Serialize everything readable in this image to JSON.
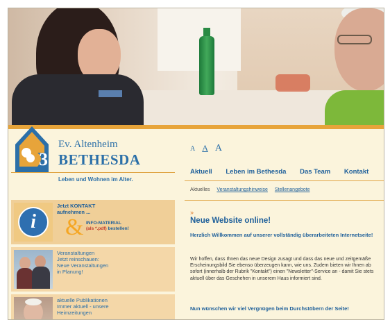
{
  "organization": {
    "name": "Ev. Altenheim",
    "title": "BETHESDA",
    "tagline": "Leben und Wohnen im Alter."
  },
  "font_size_controls": [
    "A",
    "A",
    "A"
  ],
  "nav": {
    "items": [
      "Aktuell",
      "Leben im Bethesda",
      "Das Team",
      "Kontakt"
    ]
  },
  "sub_nav": {
    "current": "Aktuelles",
    "links": [
      "Veranstaltungshinweise",
      "Stellenangebote"
    ]
  },
  "sidebar": {
    "contact": {
      "line1": "Jetzt KONTAKT",
      "line2": "aufnehmen ...",
      "info_line1": "INFO-MATERIAL",
      "info_line2a": "(als *.pdf)",
      "info_line2b": "bestellen!"
    },
    "events": {
      "title": "Veranstaltungen",
      "lines": [
        "Jetzt reinschauen:",
        "Neue Veranstaltungen",
        "in Planung!"
      ]
    },
    "publications": {
      "title": "aktuelle Publikationen",
      "lines": [
        "Immer aktuell - unsere",
        "Heimzeitungen",
        "..."
      ]
    }
  },
  "article": {
    "title": "Neue Website online!",
    "intro": "Herzlich Willkommen auf unserer vollständig überarbeiteten Internetseite!",
    "body": "Wir hoffen, dass Ihnen das neue Design zusagt und dass das neue und zeitgemäße Erscheinungsbild Sie ebenso überzeugen kann, wie uns. Zudem bieten wir Ihnen ab sofort (innerhalb der Rubrik \"Kontakt\") einen \"Newsletter\"-Service an - damit Sie stets aktuell über das Geschehen in unserem Haus informiert sind.",
    "closing": "Nun wünschen wir viel Vergnügen beim Durchstöbern der Seite!"
  },
  "colors": {
    "accent": "#e7a43a",
    "brand_blue": "#2b6fa8",
    "background": "#fbf4dc"
  }
}
